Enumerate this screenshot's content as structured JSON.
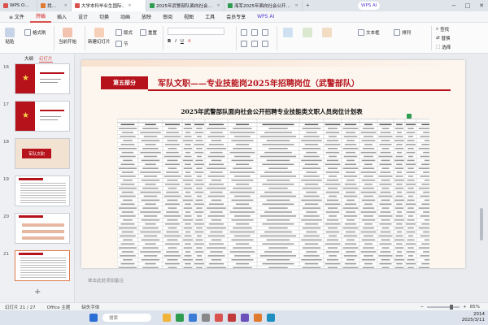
{
  "window": {
    "tabs": [
      {
        "label": "WPS Office",
        "color": "#d9534f"
      },
      {
        "label": "找稻壳模板",
        "color": "#e07a2e"
      },
      {
        "label": "大学本科毕业生国际..",
        "color": "#d9534f"
      },
      {
        "label": "2025年武警部队面向社会公开..",
        "color": "#2e9d4f"
      },
      {
        "label": "海军2025年面向社会公开招考文..",
        "color": "#2e9d4f"
      }
    ],
    "add_tab": "+",
    "wps_ai": "WPS AI",
    "minimize": "−",
    "maximize": "□",
    "close": "✕"
  },
  "menubar": {
    "file": "≡ 文件",
    "items": [
      "开始",
      "插入",
      "设计",
      "切换",
      "动画",
      "放映",
      "审阅",
      "视图",
      "工具",
      "会员专享"
    ],
    "active": "开始",
    "wps_ai": "WPS AI"
  },
  "ribbon": {
    "paste": "粘贴",
    "format_painter": "格式刷",
    "from_current": "当前开始",
    "new_slide": "新建幻灯片",
    "layout": "版式",
    "section": "节",
    "reset": "重置",
    "text_box": "文本框",
    "arrange": "排列",
    "find": "查找",
    "replace": "替换",
    "select": "选择"
  },
  "leftpanel": {
    "tab_outline": "大纲",
    "tab_slides": "幻灯片",
    "slides": [
      {
        "num": "16",
        "kind": "star"
      },
      {
        "num": "17",
        "kind": "star"
      },
      {
        "num": "18",
        "kind": "banner",
        "text": "军队文职"
      },
      {
        "num": "19",
        "kind": "table"
      },
      {
        "num": "20",
        "kind": "bars"
      },
      {
        "num": "21",
        "kind": "table",
        "selected": true
      }
    ],
    "add": "+"
  },
  "slide": {
    "section_label": "第五部分",
    "banner_title": "军队文职——专业技能岗2025年招聘岗位（武警部队）",
    "table_title": "2025年武警部队面向社会公开招聘专业技能类文职人员岗位计划表"
  },
  "notes_placeholder": "单击此处添加备注",
  "statusbar": {
    "slide_count": "幻灯片 21 / 27",
    "theme": "Office 主题",
    "missing_font": "缺失字体",
    "zoom": "85%"
  },
  "taskbar": {
    "time": "2014",
    "date": "2025/3/11",
    "search_placeholder": "搜索"
  }
}
